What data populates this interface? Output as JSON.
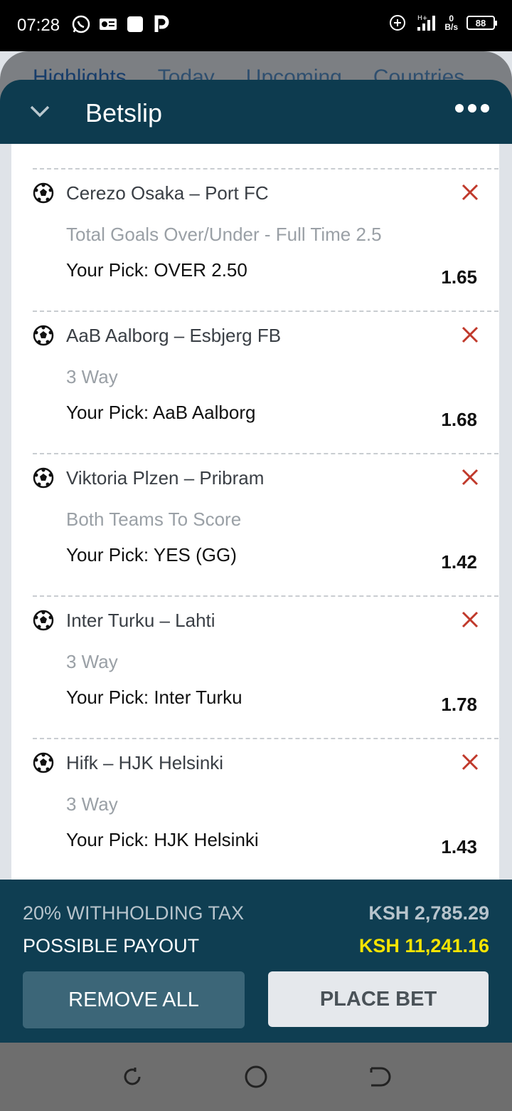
{
  "status_bar": {
    "time": "07:28",
    "net_speed_value": "0",
    "net_speed_unit": "B/s",
    "battery": "88"
  },
  "background_tabs": [
    "Highlights",
    "Today",
    "Upcoming",
    "Countries"
  ],
  "header": {
    "title": "Betslip"
  },
  "bets": [
    {
      "match": "Cerezo Osaka – Port FC",
      "market": "Total Goals Over/Under - Full Time 2.5",
      "pick": "Your Pick: OVER 2.50",
      "odds": "1.65"
    },
    {
      "match": "AaB Aalborg – Esbjerg FB",
      "market": "3 Way",
      "pick": "Your Pick: AaB Aalborg",
      "odds": "1.68"
    },
    {
      "match": "Viktoria Plzen – Pribram",
      "market": "Both Teams To Score",
      "pick": "Your Pick: YES (GG)",
      "odds": "1.42"
    },
    {
      "match": "Inter Turku – Lahti",
      "market": "3 Way",
      "pick": "Your Pick: Inter Turku",
      "odds": "1.78"
    },
    {
      "match": "Hifk – HJK Helsinki",
      "market": "3 Way",
      "pick": "Your Pick: HJK Helsinki",
      "odds": "1.43"
    }
  ],
  "footer": {
    "tax_label": "20% WITHHOLDING TAX",
    "tax_value": "KSH 2,785.29",
    "payout_label": "POSSIBLE PAYOUT",
    "payout_value": "KSH 11,241.16",
    "remove_all_label": "REMOVE ALL",
    "place_bet_label": "PLACE BET"
  },
  "colors": {
    "header_bg": "#0d3b4f",
    "footer_bg": "#0f3e52",
    "payout_accent": "#f5e400",
    "remove_x": "#c0392b"
  }
}
